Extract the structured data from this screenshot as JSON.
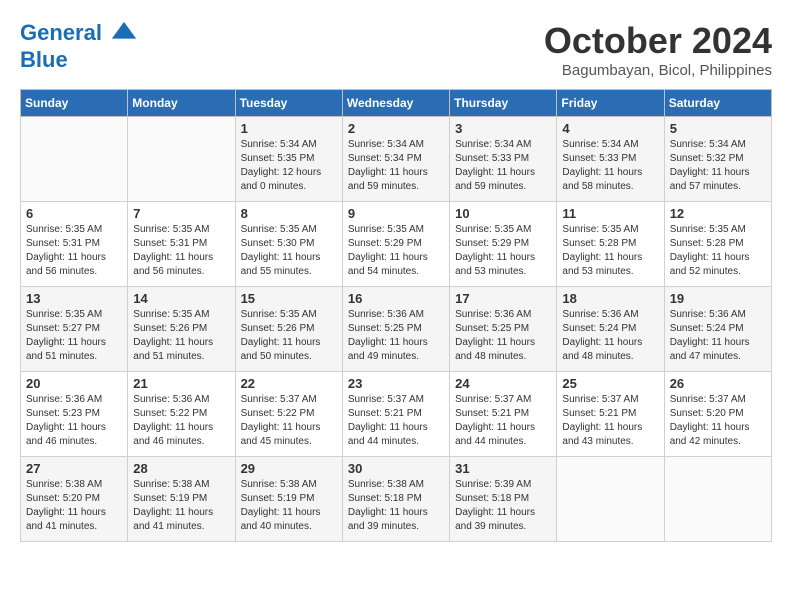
{
  "header": {
    "logo_line1": "General",
    "logo_line2": "Blue",
    "month": "October 2024",
    "location": "Bagumbayan, Bicol, Philippines"
  },
  "weekdays": [
    "Sunday",
    "Monday",
    "Tuesday",
    "Wednesday",
    "Thursday",
    "Friday",
    "Saturday"
  ],
  "weeks": [
    [
      {
        "day": "",
        "info": ""
      },
      {
        "day": "",
        "info": ""
      },
      {
        "day": "1",
        "info": "Sunrise: 5:34 AM\nSunset: 5:35 PM\nDaylight: 12 hours and 0 minutes."
      },
      {
        "day": "2",
        "info": "Sunrise: 5:34 AM\nSunset: 5:34 PM\nDaylight: 11 hours and 59 minutes."
      },
      {
        "day": "3",
        "info": "Sunrise: 5:34 AM\nSunset: 5:33 PM\nDaylight: 11 hours and 59 minutes."
      },
      {
        "day": "4",
        "info": "Sunrise: 5:34 AM\nSunset: 5:33 PM\nDaylight: 11 hours and 58 minutes."
      },
      {
        "day": "5",
        "info": "Sunrise: 5:34 AM\nSunset: 5:32 PM\nDaylight: 11 hours and 57 minutes."
      }
    ],
    [
      {
        "day": "6",
        "info": "Sunrise: 5:35 AM\nSunset: 5:31 PM\nDaylight: 11 hours and 56 minutes."
      },
      {
        "day": "7",
        "info": "Sunrise: 5:35 AM\nSunset: 5:31 PM\nDaylight: 11 hours and 56 minutes."
      },
      {
        "day": "8",
        "info": "Sunrise: 5:35 AM\nSunset: 5:30 PM\nDaylight: 11 hours and 55 minutes."
      },
      {
        "day": "9",
        "info": "Sunrise: 5:35 AM\nSunset: 5:29 PM\nDaylight: 11 hours and 54 minutes."
      },
      {
        "day": "10",
        "info": "Sunrise: 5:35 AM\nSunset: 5:29 PM\nDaylight: 11 hours and 53 minutes."
      },
      {
        "day": "11",
        "info": "Sunrise: 5:35 AM\nSunset: 5:28 PM\nDaylight: 11 hours and 53 minutes."
      },
      {
        "day": "12",
        "info": "Sunrise: 5:35 AM\nSunset: 5:28 PM\nDaylight: 11 hours and 52 minutes."
      }
    ],
    [
      {
        "day": "13",
        "info": "Sunrise: 5:35 AM\nSunset: 5:27 PM\nDaylight: 11 hours and 51 minutes."
      },
      {
        "day": "14",
        "info": "Sunrise: 5:35 AM\nSunset: 5:26 PM\nDaylight: 11 hours and 51 minutes."
      },
      {
        "day": "15",
        "info": "Sunrise: 5:35 AM\nSunset: 5:26 PM\nDaylight: 11 hours and 50 minutes."
      },
      {
        "day": "16",
        "info": "Sunrise: 5:36 AM\nSunset: 5:25 PM\nDaylight: 11 hours and 49 minutes."
      },
      {
        "day": "17",
        "info": "Sunrise: 5:36 AM\nSunset: 5:25 PM\nDaylight: 11 hours and 48 minutes."
      },
      {
        "day": "18",
        "info": "Sunrise: 5:36 AM\nSunset: 5:24 PM\nDaylight: 11 hours and 48 minutes."
      },
      {
        "day": "19",
        "info": "Sunrise: 5:36 AM\nSunset: 5:24 PM\nDaylight: 11 hours and 47 minutes."
      }
    ],
    [
      {
        "day": "20",
        "info": "Sunrise: 5:36 AM\nSunset: 5:23 PM\nDaylight: 11 hours and 46 minutes."
      },
      {
        "day": "21",
        "info": "Sunrise: 5:36 AM\nSunset: 5:22 PM\nDaylight: 11 hours and 46 minutes."
      },
      {
        "day": "22",
        "info": "Sunrise: 5:37 AM\nSunset: 5:22 PM\nDaylight: 11 hours and 45 minutes."
      },
      {
        "day": "23",
        "info": "Sunrise: 5:37 AM\nSunset: 5:21 PM\nDaylight: 11 hours and 44 minutes."
      },
      {
        "day": "24",
        "info": "Sunrise: 5:37 AM\nSunset: 5:21 PM\nDaylight: 11 hours and 44 minutes."
      },
      {
        "day": "25",
        "info": "Sunrise: 5:37 AM\nSunset: 5:21 PM\nDaylight: 11 hours and 43 minutes."
      },
      {
        "day": "26",
        "info": "Sunrise: 5:37 AM\nSunset: 5:20 PM\nDaylight: 11 hours and 42 minutes."
      }
    ],
    [
      {
        "day": "27",
        "info": "Sunrise: 5:38 AM\nSunset: 5:20 PM\nDaylight: 11 hours and 41 minutes."
      },
      {
        "day": "28",
        "info": "Sunrise: 5:38 AM\nSunset: 5:19 PM\nDaylight: 11 hours and 41 minutes."
      },
      {
        "day": "29",
        "info": "Sunrise: 5:38 AM\nSunset: 5:19 PM\nDaylight: 11 hours and 40 minutes."
      },
      {
        "day": "30",
        "info": "Sunrise: 5:38 AM\nSunset: 5:18 PM\nDaylight: 11 hours and 39 minutes."
      },
      {
        "day": "31",
        "info": "Sunrise: 5:39 AM\nSunset: 5:18 PM\nDaylight: 11 hours and 39 minutes."
      },
      {
        "day": "",
        "info": ""
      },
      {
        "day": "",
        "info": ""
      }
    ]
  ]
}
